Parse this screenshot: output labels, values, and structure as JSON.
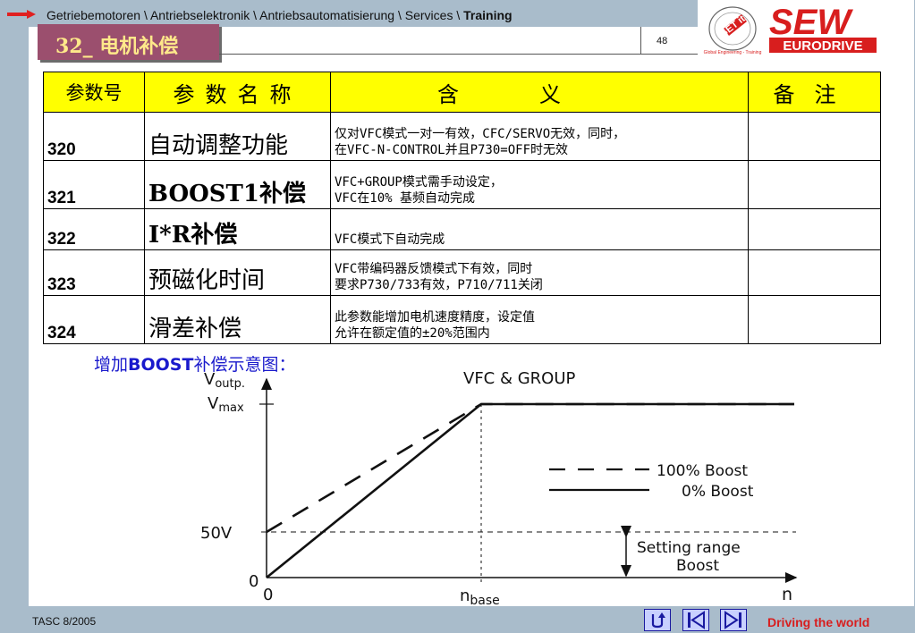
{
  "header": {
    "breadcrumb": "Getriebemotoren \\ Antriebselektronik \\ Antriebsautomatisierung \\ Services \\ ",
    "breadcrumb_bold": "Training",
    "slide_title": "32_ 电机补偿",
    "page_number": "48",
    "logo_get_text": "GET it",
    "logo_get_tagline": "Global Engineering - Training",
    "logo_sew_text": "SEW",
    "logo_eurodrive_text": "EURODRIVE"
  },
  "table": {
    "headers": [
      "参数号",
      "参数名称",
      "含义",
      "备注"
    ],
    "rows": [
      {
        "no": "320",
        "name": "自动调整功能",
        "meaning": [
          "仅对VFC模式一对一有效，CFC/SERVO无效，同时，",
          "在VFC-N-CONTROL并且P730=OFF时无效"
        ],
        "remark": ""
      },
      {
        "no": "321",
        "name": "BOOST1补偿",
        "meaning": [
          "VFC+GROUP模式需手动设定，",
          "VFC在10% 基频自动完成"
        ],
        "remark": ""
      },
      {
        "no": "322",
        "name": "I*R补偿",
        "meaning": [
          "VFC模式下自动完成"
        ],
        "remark": ""
      },
      {
        "no": "323",
        "name": "预磁化时间",
        "meaning": [
          "VFC带编码器反馈模式下有效，同时",
          "要求P730/733有效，P710/711关闭"
        ],
        "remark": ""
      },
      {
        "no": "324",
        "name": "滑差补偿",
        "meaning": [
          "此参数能增加电机速度精度，设定值",
          "允许在额定值的±20%范围内"
        ],
        "remark": ""
      }
    ]
  },
  "diagram": {
    "caption_prefix": "增加",
    "caption_bold": "BOOST",
    "caption_suffix": "补偿示意图：",
    "title": "VFC & GROUP",
    "y_axis_label": "V",
    "y_axis_label_sub": "outp.",
    "vmax_label": "V",
    "vmax_label_sub": "max",
    "v50_label": "50V",
    "origin_y_label": "0",
    "origin_x_label": "0",
    "nbase_label": "n",
    "nbase_label_sub": "base",
    "x_axis_label": "n",
    "legend_dashed": "100% Boost",
    "legend_solid": "0% Boost",
    "range_label_line1": "Setting range",
    "range_label_line2": "Boost"
  },
  "chart_data": {
    "type": "line",
    "title": "VFC & GROUP",
    "xlabel": "n",
    "ylabel": "Voutp.",
    "x_ticks": [
      "0",
      "nbase"
    ],
    "y_ticks": [
      "0",
      "50V",
      "Vmax"
    ],
    "series": [
      {
        "name": "100% Boost",
        "style": "dashed",
        "points": [
          [
            "0",
            "50V"
          ],
          [
            "nbase",
            "Vmax"
          ],
          [
            "beyond",
            "Vmax"
          ]
        ]
      },
      {
        "name": "0% Boost",
        "style": "solid",
        "points": [
          [
            "0",
            "0"
          ],
          [
            "nbase",
            "Vmax"
          ],
          [
            "beyond",
            "Vmax"
          ]
        ]
      }
    ],
    "annotations": [
      "Setting range Boost"
    ]
  },
  "footer": {
    "left": "TASC 8/2005",
    "right": "Driving the world"
  },
  "colors": {
    "background": "#a9bccb",
    "title_box": "#9b4f6e",
    "title_text": "#ffe98a",
    "table_header": "#ffff00",
    "caption_text": "#1a1acc",
    "footer_right": "#d81e1e",
    "logo_red": "#d81e1e"
  }
}
